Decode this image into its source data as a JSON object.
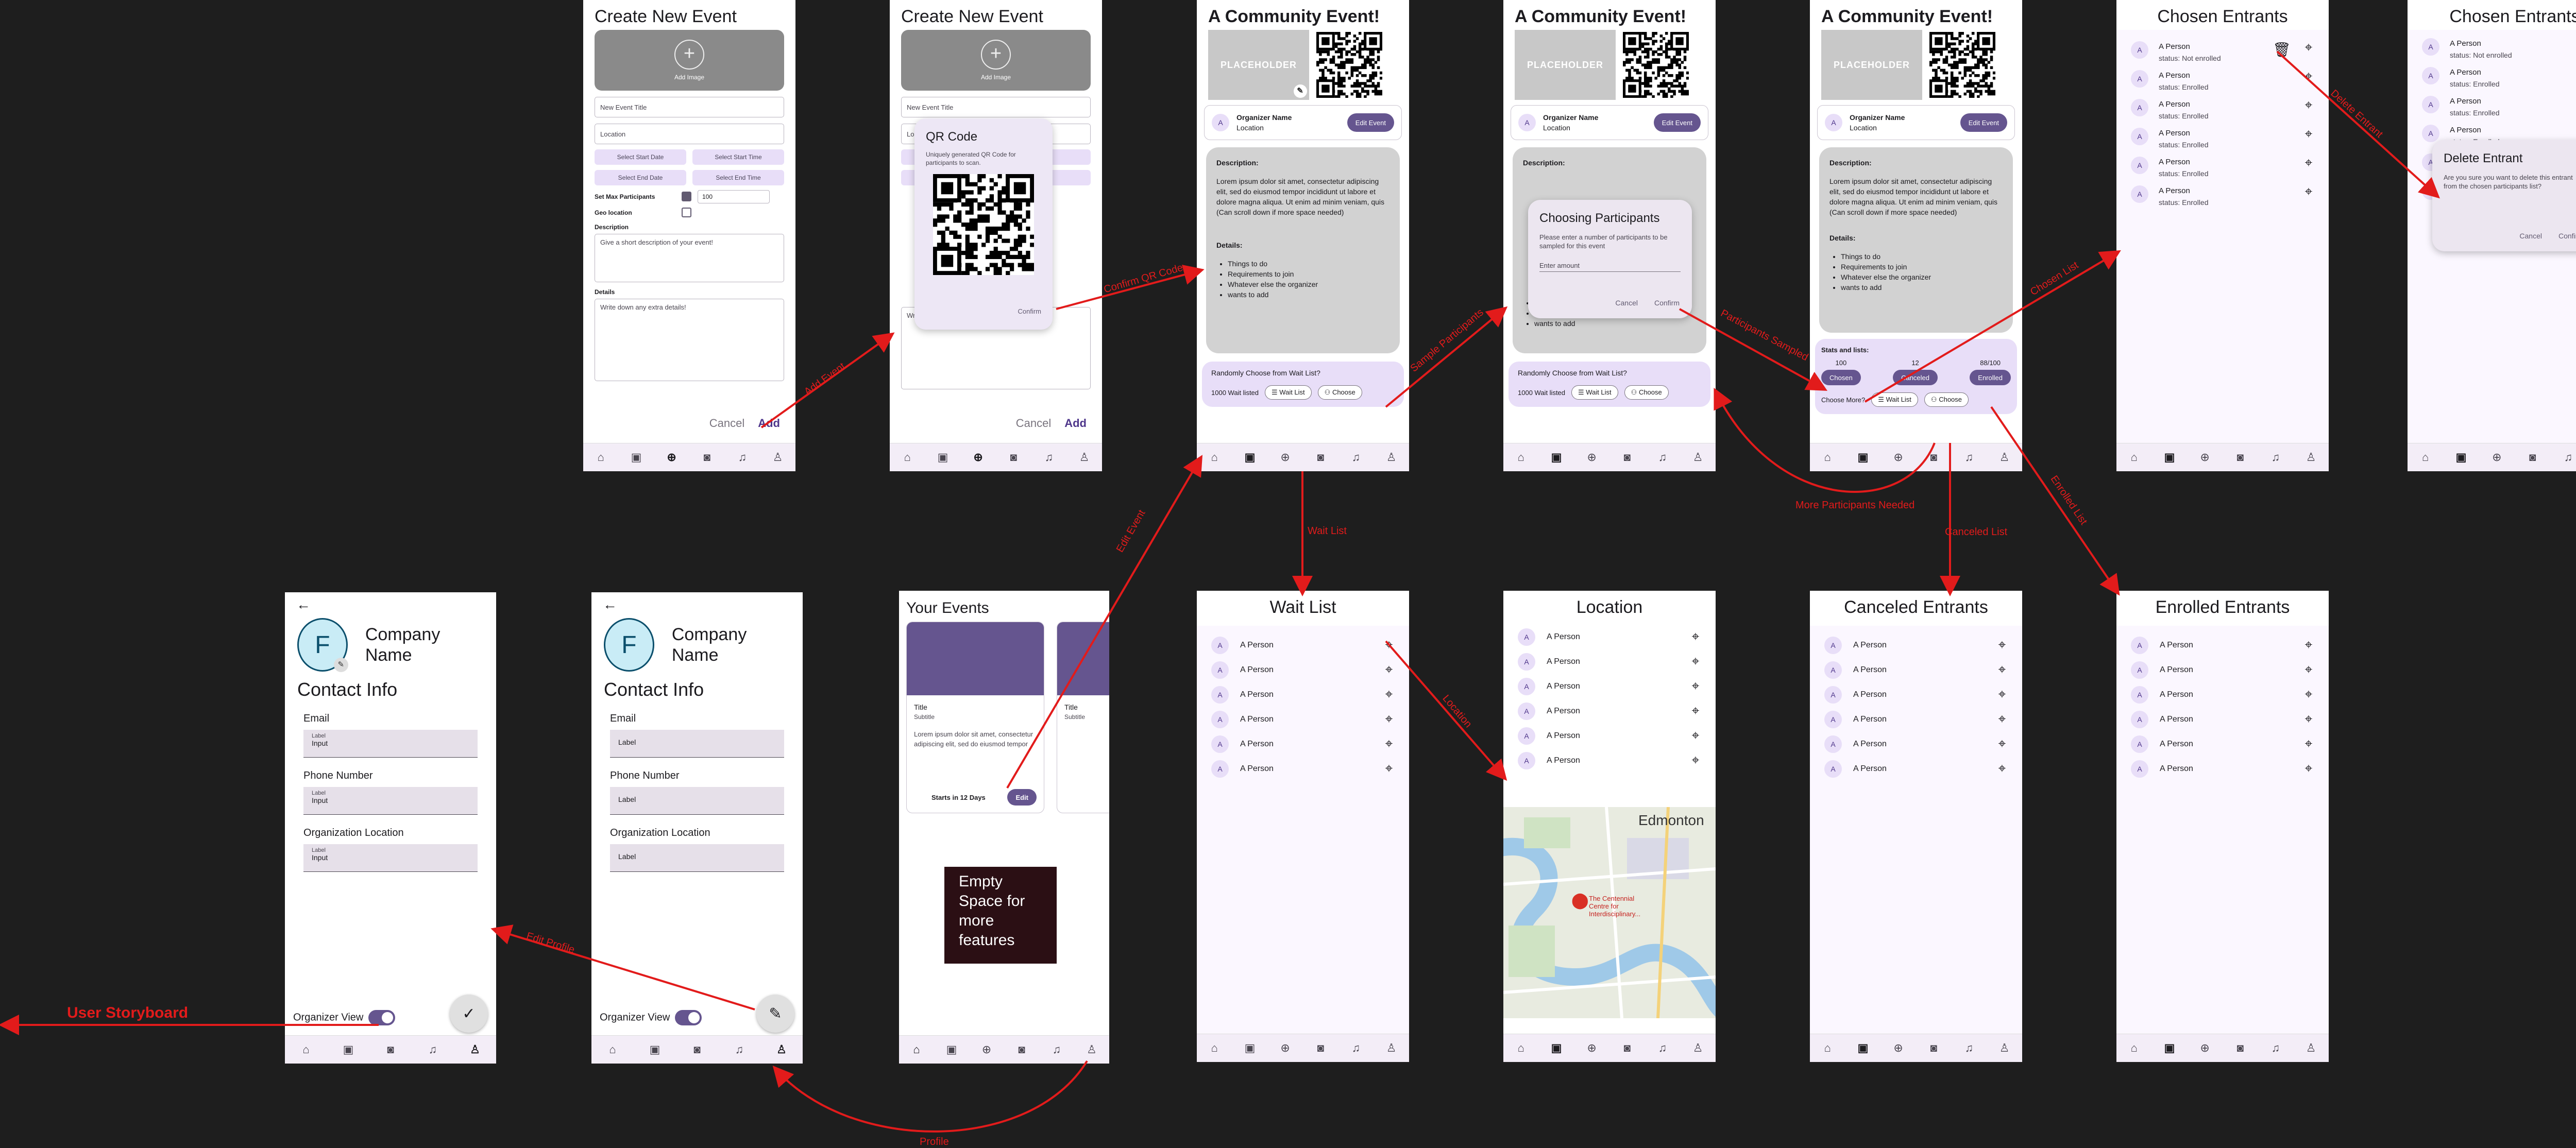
{
  "nav_icons": [
    "home-icon",
    "ticket-icon",
    "add-circle-icon",
    "camera-icon",
    "bell-icon",
    "person-icon"
  ],
  "create": {
    "title": "Create New Event",
    "add_image": "Add Image",
    "title_placeholder": "New Event Title",
    "location_placeholder": "Location",
    "start_date": "Select Start Date",
    "start_time": "Select Start Time",
    "end_date": "Select End Date",
    "end_time": "Select End Time",
    "max_participants_label": "Set Max Participants",
    "max_participants_value": "100",
    "geo_label": "Geo location",
    "description_label": "Description",
    "description_placeholder": "Give a short description of your event!",
    "details_label": "Details",
    "details_placeholder": "Write down any extra details!",
    "cancel": "Cancel",
    "add": "Add"
  },
  "qr_dialog": {
    "title": "QR Code",
    "text": "Uniquely generated QR Code for participants to scan.",
    "confirm": "Confirm"
  },
  "event": {
    "title": "A Community Event!",
    "placeholder": "PLACEHOLDER",
    "organizer": "Organizer Name",
    "location": "Location",
    "edit_event": "Edit Event",
    "description_label": "Description:",
    "description": "Lorem ipsum dolor sit amet, consectetur adipiscing elit, sed do eiusmod tempor incididunt ut labore et dolore magna aliqua. Ut enim ad minim veniam, quis",
    "scroll_note": "(Can scroll down if more space needed)",
    "details_label": "Details:",
    "details": [
      "Things to do",
      "Requirements to join",
      "Whatever else the organizer",
      "wants to add"
    ],
    "random_title": "Randomly Choose from Wait List?",
    "wait_listed": "1000 Wait listed",
    "wait_list_btn": "Wait List",
    "choose_btn": "Choose"
  },
  "choosing_dialog": {
    "title": "Choosing Participants",
    "text": "Please enter a number of participants to be sampled for this event",
    "input_label": "Enter amount",
    "cancel": "Cancel",
    "confirm": "Confirm"
  },
  "stats": {
    "label": "Stats and lists:",
    "chosen_count": "100",
    "canceled_count": "12",
    "enrolled_count": "88/100",
    "chosen": "Chosen",
    "canceled": "Canceled",
    "enrolled": "Enrolled",
    "choose_more": "Choose More?"
  },
  "chosen": {
    "title": "Chosen Entrants",
    "rows": [
      {
        "name": "A Person",
        "status": "status: Not enrolled"
      },
      {
        "name": "A Person",
        "status": "status: Enrolled"
      },
      {
        "name": "A Person",
        "status": "status: Enrolled"
      },
      {
        "name": "A Person",
        "status": "status: Enrolled"
      },
      {
        "name": "A Person",
        "status": "status: Enrolled"
      },
      {
        "name": "A Person",
        "status": "status: Enrolled"
      }
    ]
  },
  "delete_dialog": {
    "title": "Delete Entrant",
    "text": "Are you sure you want to delete this entrant from the chosen participants list?",
    "cancel": "Cancel",
    "confirm": "Confirm"
  },
  "wait_list": {
    "title": "Wait List"
  },
  "location_screen": {
    "title": "Location",
    "city": "Edmonton",
    "place": "The Centennial Centre for Interdisciplinary..."
  },
  "canceled": {
    "title": "Canceled Entrants"
  },
  "enrolled": {
    "title": "Enrolled Entrants"
  },
  "person_name": "A Person",
  "avatar_letter": "A",
  "your_events": {
    "title": "Your Events",
    "card_title": "Title",
    "card_subtitle": "Subtitle",
    "card_text": "Lorem ipsum dolor sit amet, consectetur adipiscing elit, sed do eiusmod tempor",
    "starts": "Starts in 12 Days",
    "edit": "Edit",
    "empty_space": "Empty Space for more features"
  },
  "profile": {
    "letter": "F",
    "company": "Company Name",
    "contact_info": "Contact Info",
    "email": "Email",
    "phone": "Phone Number",
    "org_location": "Organization Location",
    "field_label": "Label",
    "input": "Input",
    "organizer_view": "Organizer View"
  },
  "arrows": {
    "add_event": "Add Event",
    "confirm_qr": "Confirm QR Code",
    "sample_participants": "Sample Participants",
    "participants_sampled": "Participants Sampled",
    "chosen_list": "Chosen List",
    "delete_entrant": "Delete Entrant",
    "wait_list": "Wait List",
    "location": "Location",
    "more_needed": "More Participants Needed",
    "canceled_list": "Canceled List",
    "enrolled_list": "Enrolled List",
    "edit_event": "Edit Event",
    "edit_profile": "Edit Profile",
    "profile": "Profile",
    "user_storyboard": "User Storyboard"
  }
}
